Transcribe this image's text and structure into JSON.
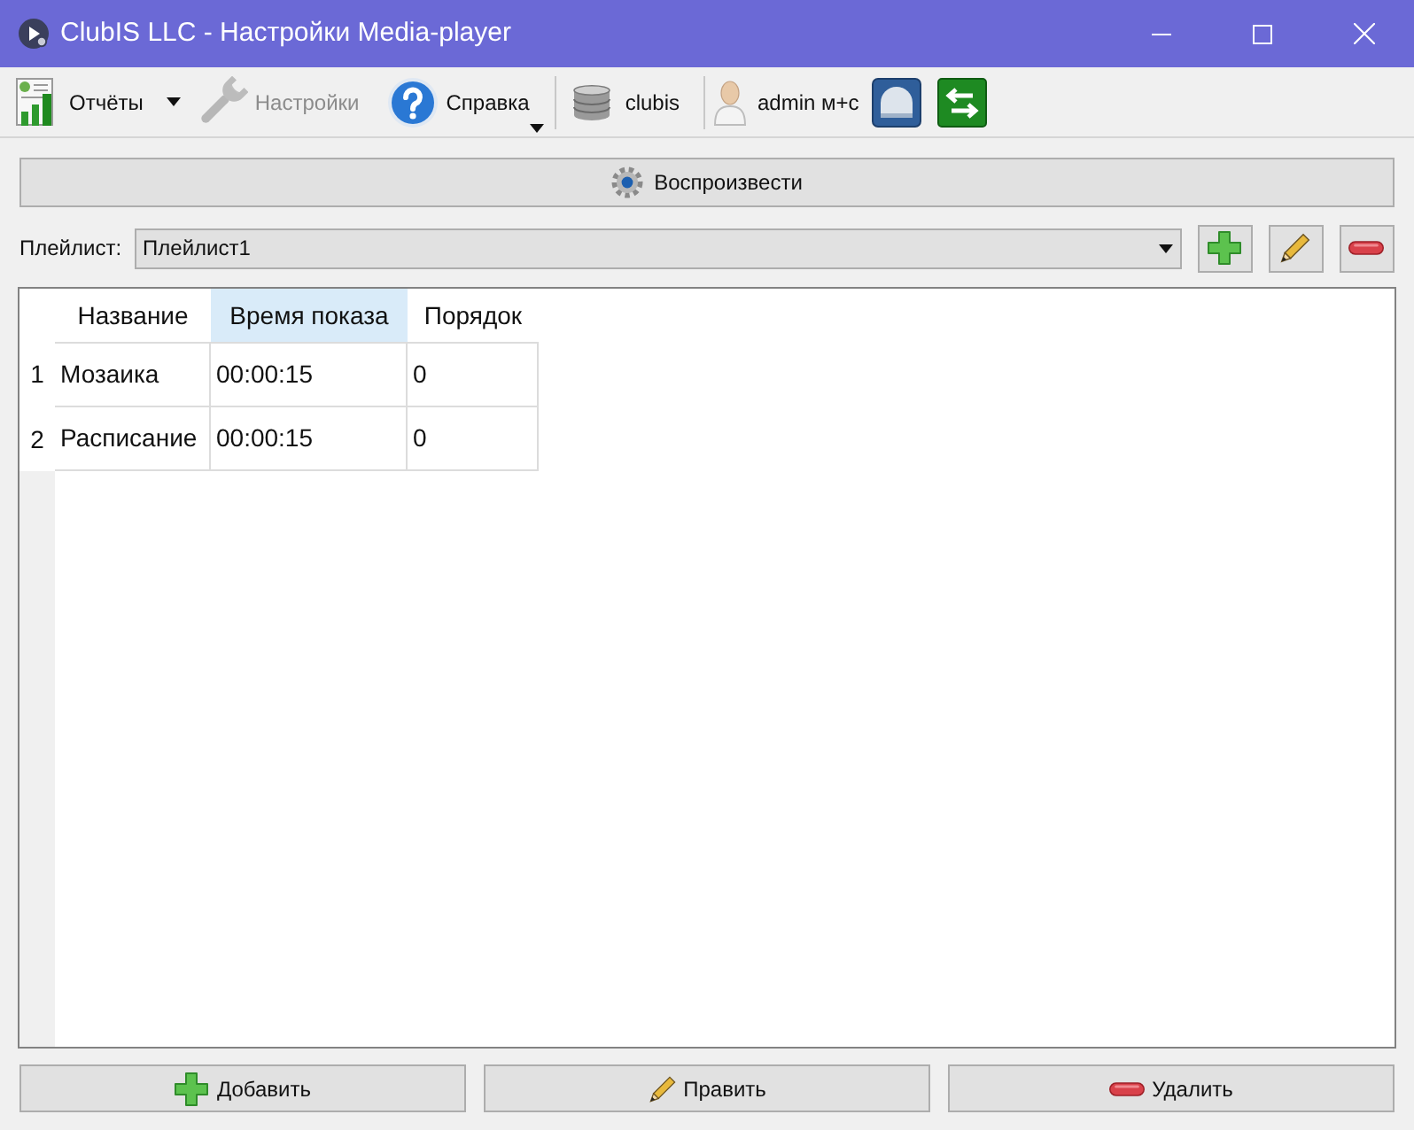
{
  "window": {
    "title": "ClubIS LLC - Настройки Media-player"
  },
  "toolbar": {
    "reports": {
      "label": "Отчёты",
      "disabled": false
    },
    "settings": {
      "label": "Настройки",
      "disabled": true
    },
    "help": {
      "label": "Справка",
      "disabled": false
    },
    "database": {
      "label": "clubis"
    },
    "user": {
      "label": "admin м+с"
    }
  },
  "play_button": {
    "label": "Воспроизвести"
  },
  "playlist": {
    "label": "Плейлист:",
    "value": "Плейлист1"
  },
  "table": {
    "columns": [
      {
        "label": "Название",
        "selected": false
      },
      {
        "label": "Время показа",
        "selected": true
      },
      {
        "label": "Порядок",
        "selected": false
      }
    ],
    "rows": [
      {
        "number": "1",
        "cells": [
          "Мозаика",
          "00:00:15",
          "0"
        ]
      },
      {
        "number": "2",
        "cells": [
          "Расписание",
          "00:00:15",
          "0"
        ]
      }
    ]
  },
  "buttons": [
    {
      "kind": "add",
      "label": "Добавить"
    },
    {
      "kind": "edit",
      "label": "Править"
    },
    {
      "kind": "delete",
      "label": "Удалить"
    }
  ]
}
